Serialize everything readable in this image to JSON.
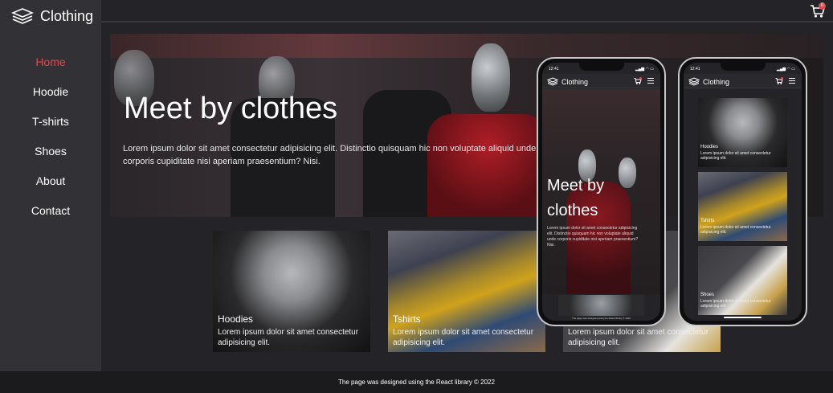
{
  "brand": {
    "name": "Clothing",
    "icon": "layers-icon"
  },
  "nav": {
    "items": [
      {
        "label": "Home",
        "active": true
      },
      {
        "label": "Hoodie",
        "active": false
      },
      {
        "label": "T-shirts",
        "active": false
      },
      {
        "label": "Shoes",
        "active": false
      },
      {
        "label": "About",
        "active": false
      },
      {
        "label": "Contact",
        "active": false
      }
    ]
  },
  "cart": {
    "count": "0",
    "icon": "cart-icon"
  },
  "hero": {
    "title": "Meet by clothes",
    "description": "Lorem ipsum dolor sit amet consectetur adipisicing elit. Distinctio quisquam hic non voluptate aliquid unde corporis cupiditate nisi aperiam praesentium? Nisi."
  },
  "cards": [
    {
      "title": "Hoodies",
      "description": "Lorem ipsum dolor sit amet consectetur adipisicing elit."
    },
    {
      "title": "Tshirts",
      "description": "Lorem ipsum dolor sit amet consectetur adipisicing elit."
    },
    {
      "title": "Shoes",
      "description": "Lorem ipsum dolor sit amet consectetur adipisicing elit."
    }
  ],
  "footer": {
    "text": "The page was designed using the React library © 2022"
  },
  "phone": {
    "time": "12:41",
    "status_icons": "▂▄▆ ◠ ▭",
    "title_line1": "Meet by",
    "title_line2": "clothes",
    "description": "Lorem ipsum dolor sit amet consectetur adipisicing elit. Distinctio quisquam hic non voluptate aliquid unde corporis cupiditate nisi aperiam praesentium? Nisi.",
    "footer": "The page was designed using the React library © 2022"
  },
  "colors": {
    "accent": "#e5484d",
    "background": "#242327",
    "sidebar": "#323135"
  }
}
